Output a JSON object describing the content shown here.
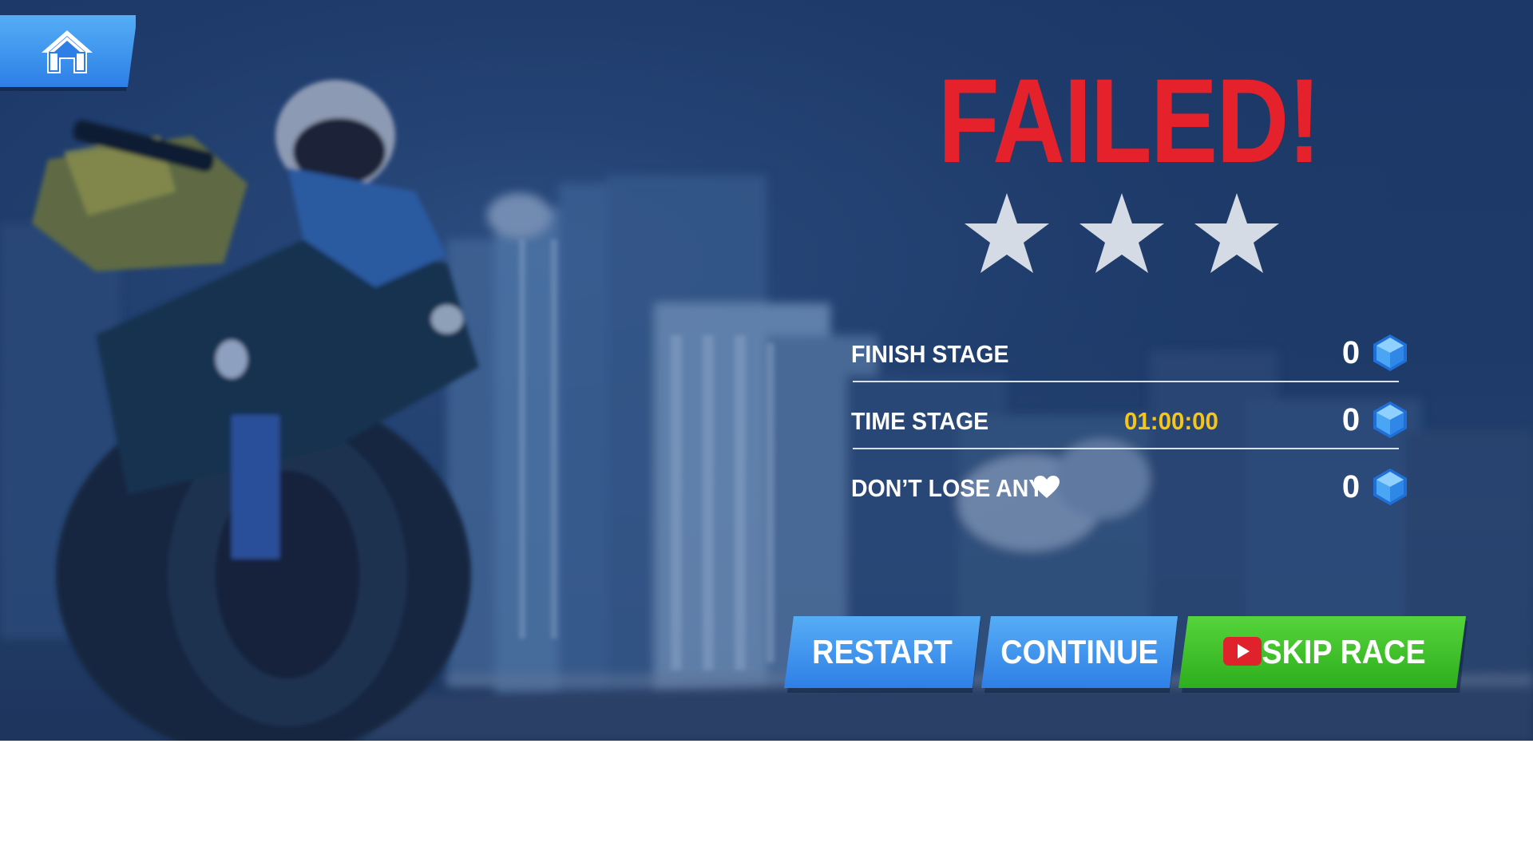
{
  "screen": {
    "title": "FAILED!",
    "stars_earned": 0,
    "stars_total": 3
  },
  "home_button": {
    "icon": "home-icon"
  },
  "objectives": [
    {
      "label": "FINISH STAGE",
      "reward": "0",
      "reward_icon": "gem-icon"
    },
    {
      "label": "TIME STAGE",
      "time": "01:00:00",
      "reward": "0",
      "reward_icon": "gem-icon"
    },
    {
      "label": "DON’T LOSE ANY",
      "label_icon": "heart-icon",
      "reward": "0",
      "reward_icon": "gem-icon"
    }
  ],
  "buttons": {
    "restart": "RESTART",
    "continue": "CONTINUE",
    "skip_race": "SKIP RACE",
    "skip_race_icon": "video-play-icon"
  },
  "colors": {
    "title": "#e5222c",
    "time": "#f5c518",
    "blue_button": "#3a8ef0",
    "green_button": "#3fbf2a",
    "overlay": "#1c3868"
  }
}
